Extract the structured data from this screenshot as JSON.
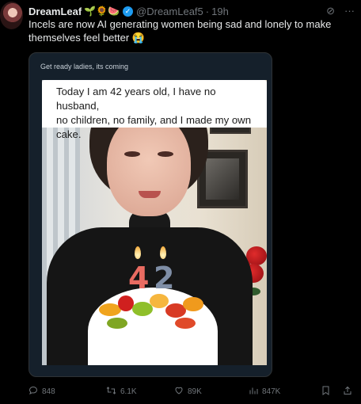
{
  "post": {
    "author_name": "DreamLeaf",
    "author_emojis": "🌱🌻🍉",
    "verified_mark": "✓",
    "handle": "@DreamLeaf5",
    "separator": "·",
    "time": "19h",
    "text": "Incels are now AI generating women being sad and lonely to make themselves feel better 😭"
  },
  "top_icons": {
    "grok": "⊘",
    "more": "···"
  },
  "card": {
    "caption": "Get ready ladies, its coming",
    "overlay_lines": [
      "Today I am 42 years old, I have no husband,",
      "no children, no family, and I made my own",
      "cake."
    ],
    "candle_digits": [
      "4",
      "2"
    ]
  },
  "actions": {
    "reply_count": "848",
    "repost_count": "6.1K",
    "like_count": "89K",
    "view_count": "847K"
  },
  "colors": {
    "accent": "#1d9bf0",
    "muted": "#71767b",
    "text": "#e7e9ea",
    "background": "#000000"
  }
}
